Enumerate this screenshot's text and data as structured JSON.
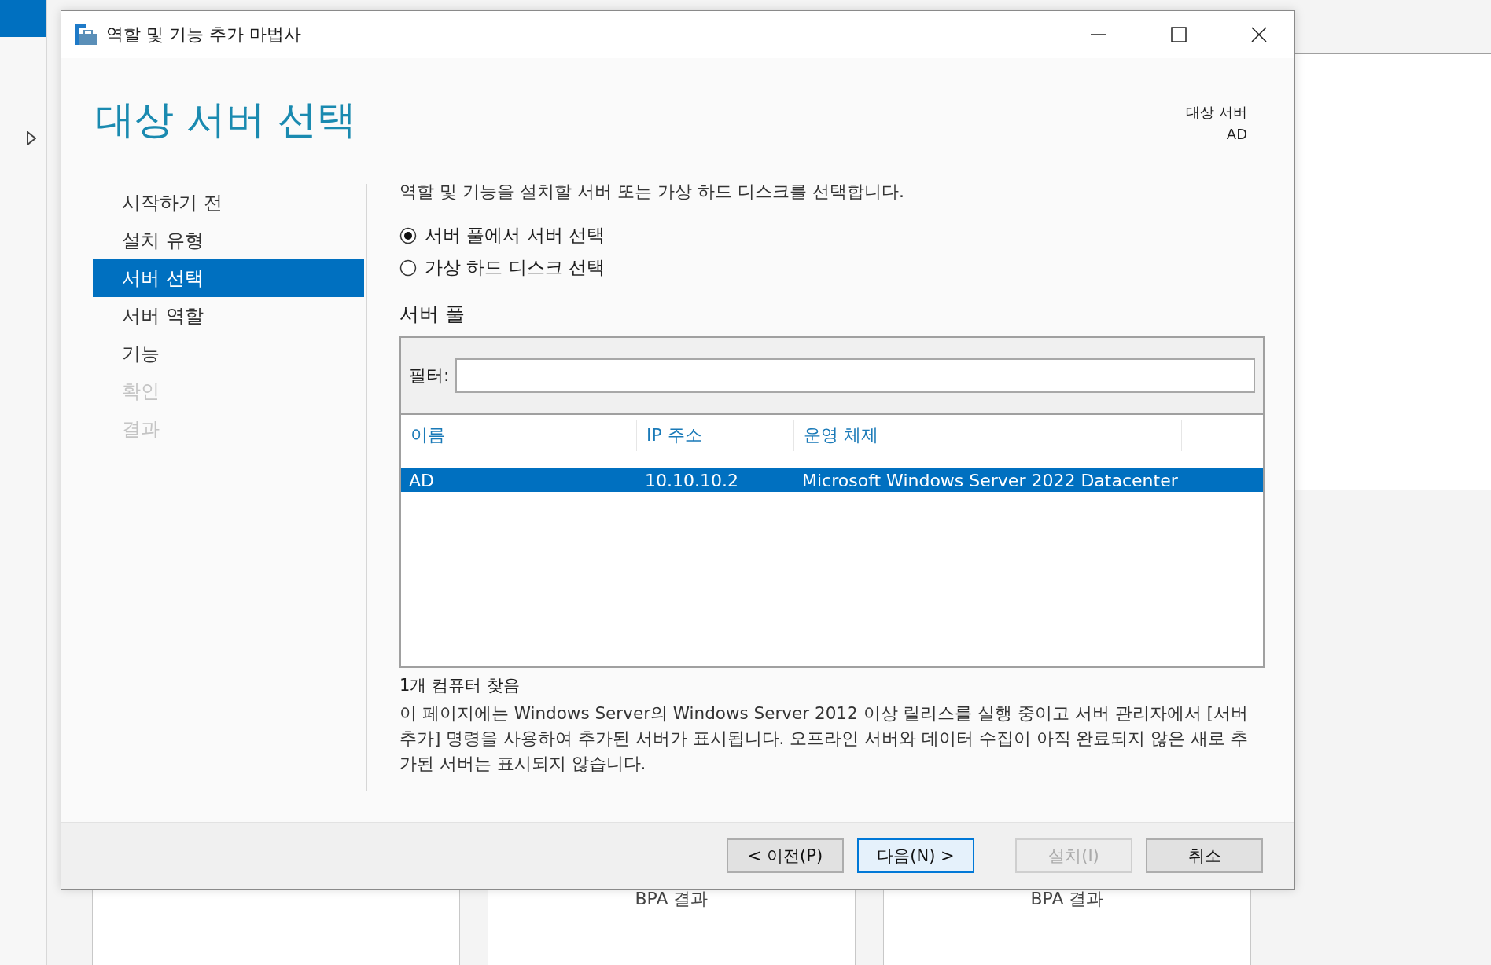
{
  "background": {
    "cards": [
      {
        "label": "BPA 결과"
      },
      {
        "label": "BPA 결과"
      }
    ]
  },
  "window": {
    "title": "역할 및 기능 추가 마법사"
  },
  "header": {
    "title": "대상 서버 선택",
    "target_label": "대상 서버",
    "target_value": "AD"
  },
  "steps": [
    {
      "label": "시작하기 전",
      "selected": false,
      "disabled": false
    },
    {
      "label": "설치 유형",
      "selected": false,
      "disabled": false
    },
    {
      "label": "서버 선택",
      "selected": true,
      "disabled": false
    },
    {
      "label": "서버 역할",
      "selected": false,
      "disabled": false
    },
    {
      "label": "기능",
      "selected": false,
      "disabled": false
    },
    {
      "label": "확인",
      "selected": false,
      "disabled": true
    },
    {
      "label": "결과",
      "selected": false,
      "disabled": true
    }
  ],
  "description": "역할 및 기능을 설치할 서버 또는 가상 하드 디스크를 선택합니다.",
  "options": [
    {
      "label": "서버 풀에서 서버 선택",
      "selected": true
    },
    {
      "label": "가상 하드 디스크 선택",
      "selected": false
    }
  ],
  "pool": {
    "title": "서버 풀",
    "filter_label": "필터:",
    "columns": [
      "이름",
      "IP 주소",
      "운영 체제"
    ],
    "rows": [
      {
        "cells": [
          "AD",
          "10.10.10.2",
          "Microsoft Windows Server 2022 Datacenter"
        ],
        "selected": true
      }
    ],
    "count": "1개 컴퓨터 찾음"
  },
  "note": "이 페이지에는 Windows Server의 Windows Server 2012 이상 릴리스를 실행 중이고 서버 관리자에서 [서버 추가] 명령을 사용하여 추가된 서버가 표시됩니다. 오프라인 서버와 데이터 수집이 아직 완료되지 않은 새로 추가된 서버는 표시되지 않습니다.",
  "buttons": [
    {
      "label": "< 이전(P)",
      "disabled": false,
      "default": false
    },
    {
      "label": "다음(N) >",
      "disabled": false,
      "default": true
    },
    {
      "label": "설치(I)",
      "disabled": true,
      "default": false
    },
    {
      "label": "취소",
      "disabled": false,
      "default": false
    }
  ]
}
